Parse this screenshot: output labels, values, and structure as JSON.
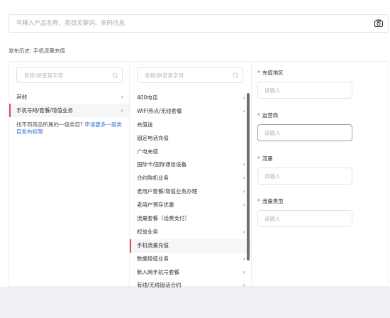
{
  "search": {
    "placeholder": "可输入产品名称、类目关键词、条码信息"
  },
  "history": {
    "text": "发布历史: 手机流量充值"
  },
  "col1": {
    "search_placeholder": "名称/拼音首字母",
    "items": [
      {
        "label": "其他",
        "chevron": "›"
      },
      {
        "label": "手机号码/套餐/增值业务",
        "chevron": "›"
      }
    ],
    "helper_text": "找不到商品所属的一级类目?",
    "helper_link": "申请更多一级类目发布权限"
  },
  "col2": {
    "search_placeholder": "名称/拼音首字母",
    "items": [
      {
        "label": "400电话",
        "chevron": "›"
      },
      {
        "label": "WIFI热点/无线套餐",
        "chevron": "›"
      },
      {
        "label": "充值送",
        "chevron": ""
      },
      {
        "label": "固定电话充值",
        "chevron": ""
      },
      {
        "label": "广电充值",
        "chevron": ""
      },
      {
        "label": "国际卡/国际通信设备",
        "chevron": "›"
      },
      {
        "label": "合约购机业务",
        "chevron": "›"
      },
      {
        "label": "老用户套餐/增值业务办理",
        "chevron": "›"
      },
      {
        "label": "老用户预存优惠",
        "chevron": "›"
      },
      {
        "label": "流量套餐（话费支付）",
        "chevron": ""
      },
      {
        "label": "权益业务",
        "chevron": "›"
      },
      {
        "label": "手机流量充值",
        "chevron": ""
      },
      {
        "label": "数据增值业务",
        "chevron": "›"
      },
      {
        "label": "新入网手机号套餐",
        "chevron": "›"
      },
      {
        "label": "有线/无线固话合约",
        "chevron": "›"
      }
    ]
  },
  "col3": {
    "fields": [
      {
        "star": "*",
        "label": "充值地区",
        "placeholder": "请输入"
      },
      {
        "star": "*",
        "label": "运营商",
        "placeholder": "请输入"
      },
      {
        "star": "*",
        "label": "流量",
        "placeholder": "请输入"
      },
      {
        "star": "*",
        "label": "流量类型",
        "placeholder": "请输入"
      }
    ]
  },
  "colors": {
    "accent": "#e2474d",
    "link": "#2f6fdc",
    "background": "#eef0f5"
  },
  "icons": {
    "camera": "camera-icon",
    "search": "search-icon"
  }
}
